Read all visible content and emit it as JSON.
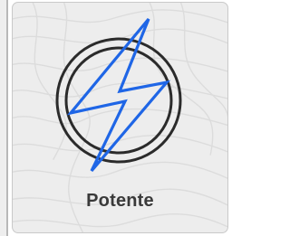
{
  "card": {
    "label": "Potente",
    "icon": "lightning-bolt-in-circle-icon",
    "accent_color": "#1f66e6",
    "outline_color": "#2b2b2b"
  }
}
